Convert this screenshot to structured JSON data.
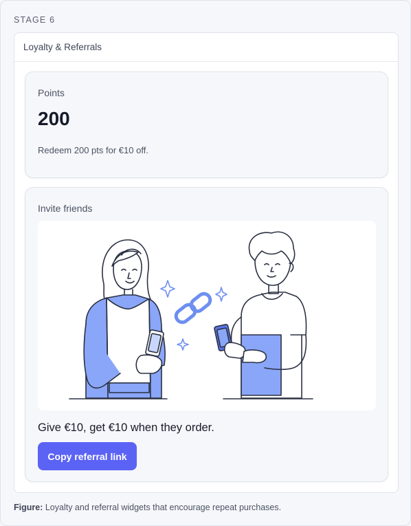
{
  "stage_label": "STAGE 6",
  "panel": {
    "title": "Loyalty & Referrals"
  },
  "points": {
    "label": "Points",
    "value": "200",
    "note": "Redeem 200 pts for €10 off."
  },
  "invite": {
    "label": "Invite friends",
    "text": "Give €10, get €10 when they order.",
    "button_label": "Copy referral link",
    "illustration_icons": [
      "woman-with-phone-icon",
      "man-with-phone-icon",
      "chain-link-icon",
      "sparkle-icon"
    ]
  },
  "caption": {
    "prefix": "Figure:",
    "text": "Loyalty and referral widgets that encourage repeat purchases."
  },
  "colors": {
    "accent": "#5b63f5",
    "illustration_blue": "#8aa6f8",
    "line": "#2b3142"
  }
}
